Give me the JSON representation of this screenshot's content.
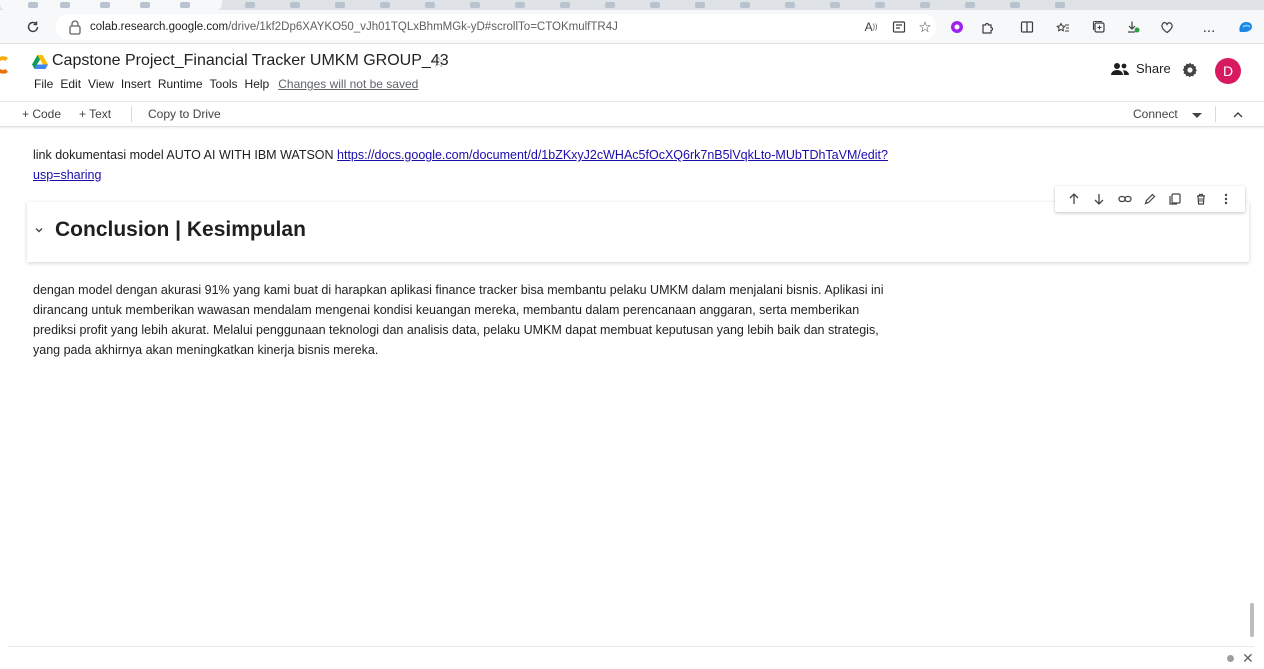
{
  "browser": {
    "url_host": "colab.research.google.com",
    "url_path": "/drive/1kf2Dp6XAYKO50_vJh01TQLxBhmMGk-yD#scrollTo=CTOKmulfTR4J",
    "extensions_more": "..."
  },
  "notebook": {
    "title": "Capstone Project_Financial Tracker UMKM GROUP_43",
    "menu": [
      "File",
      "Edit",
      "View",
      "Insert",
      "Runtime",
      "Tools",
      "Help"
    ],
    "unsaved_notice": "Changes will not be saved",
    "share_label": "Share",
    "avatar_initial": "D"
  },
  "toolbar": {
    "add_code": "+ Code",
    "add_text": "+ Text",
    "copy_to_drive": "Copy to Drive",
    "connect": "Connect"
  },
  "content": {
    "link_prefix": "link dokumentasi model AUTO AI WITH IBM WATSON ",
    "link_url": "https://docs.google.com/document/d/1bZKxyJ2cWHAc5fOcXQ6rk7nB5lVqkLto-MUbTDhTaVM/edit?usp=sharing",
    "section_heading": "Conclusion | Kesimpulan",
    "conclusion_text": "dengan model dengan akurasi 91% yang kami buat di harapkan aplikasi finance tracker bisa membantu pelaku UMKM dalam menjalani bisnis. Aplikasi ini dirancang untuk memberikan wawasan mendalam mengenai kondisi keuangan mereka, membantu dalam perencanaan anggaran, serta memberikan prediksi profit yang lebih akurat. Melalui penggunaan teknologi dan analisis data, pelaku UMKM dapat membuat keputusan yang lebih baik dan strategis, yang pada akhirnya akan meningkatkan kinerja bisnis mereka."
  },
  "colors": {
    "avatar_bg": "#d81b60",
    "link": "#1a0dab"
  }
}
